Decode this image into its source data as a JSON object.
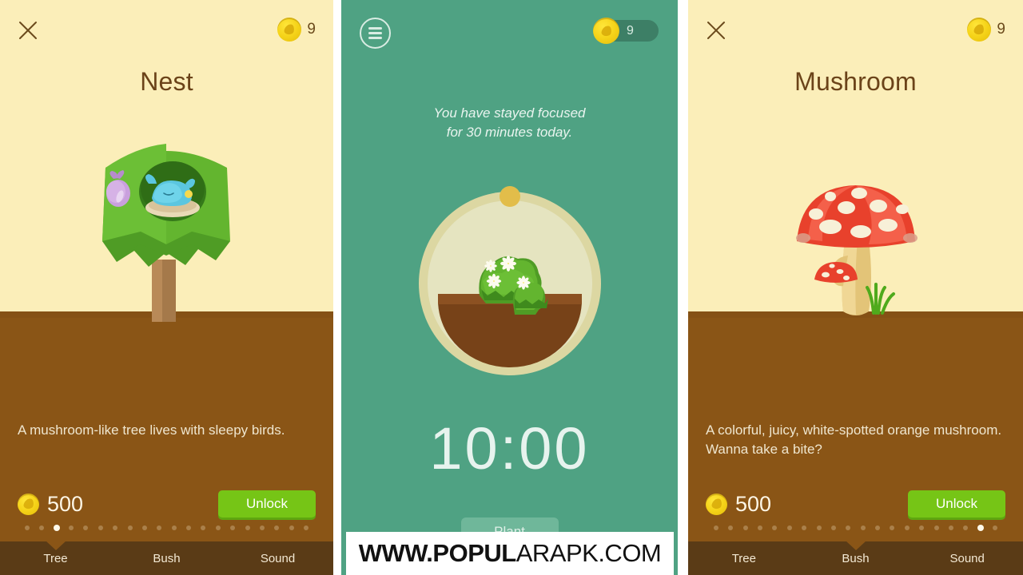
{
  "panels": {
    "left": {
      "status_icons": "signal-wifi-battery",
      "close_icon": "close-icon",
      "coin_count": "9",
      "title": "Nest",
      "illustration": "tree-with-bird-nest",
      "description": "A mushroom-like tree lives with sleepy birds.",
      "price": "500",
      "unlock_label": "Unlock",
      "dots_total": 20,
      "dots_active_index": 2,
      "tabs": [
        {
          "label": "Tree",
          "selected": true
        },
        {
          "label": "Bush",
          "selected": false
        },
        {
          "label": "Sound",
          "selected": false
        }
      ]
    },
    "middle": {
      "menu_icon": "hamburger-menu-icon",
      "coin_count": "9",
      "focus_message_line1": "You have stayed focused",
      "focus_message_line2": "for 30 minutes today.",
      "illustration": "potted-flowering-bush",
      "timer": "10:00",
      "plant_label": "Plant"
    },
    "right": {
      "close_icon": "close-icon",
      "coin_count": "9",
      "title": "Mushroom",
      "illustration": "red-white-spotted-mushroom",
      "description": "A colorful, juicy, white-spotted orange mushroom. Wanna take a bite?",
      "price": "500",
      "unlock_label": "Unlock",
      "dots_total": 20,
      "dots_active_index": 18,
      "tabs": [
        {
          "label": "Tree",
          "selected": false
        },
        {
          "label": "Bush",
          "selected": true
        },
        {
          "label": "Sound",
          "selected": false
        }
      ]
    }
  },
  "watermark": {
    "bold_part": "WWW.POPUL",
    "normal_part": "ARAPK.COM"
  },
  "colors": {
    "cream": "#fbeeb9",
    "soil": "#8a5516",
    "tabbar": "#5a3b16",
    "teal": "#4fa283",
    "unlock_green": "#76c516",
    "coin_gold": "#f6d41a"
  }
}
